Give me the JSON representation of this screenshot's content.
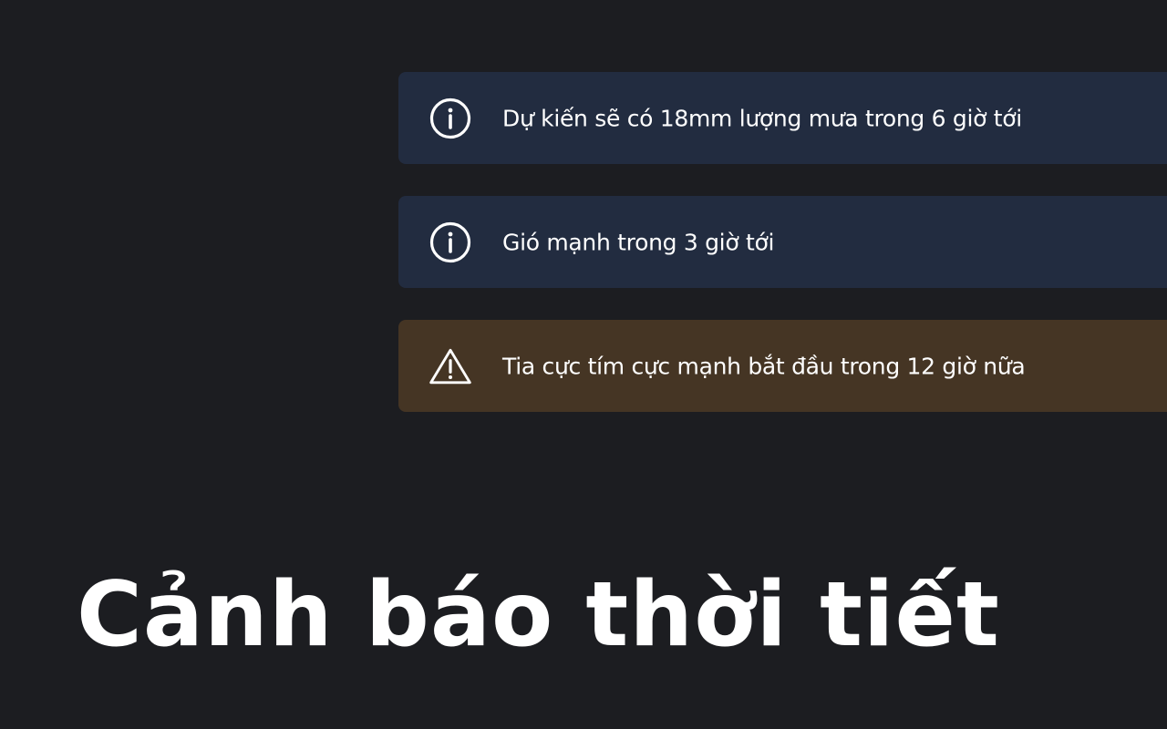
{
  "alerts": [
    {
      "type": "info",
      "icon": "info-icon",
      "text": "Dự kiến sẽ có 18mm lượng mưa trong 6 giờ tới"
    },
    {
      "type": "info",
      "icon": "info-icon",
      "text": "Gió mạnh trong 3 giờ tới"
    },
    {
      "type": "warning",
      "icon": "warning-icon",
      "text": "Tia cực tím cực mạnh bắt đầu trong 12 giờ nữa"
    }
  ],
  "headline": "Cảnh báo thời tiết",
  "colors": {
    "background": "#1c1d21",
    "info_bg": "#222c40",
    "warning_bg": "#453524",
    "text": "#ffffff"
  }
}
